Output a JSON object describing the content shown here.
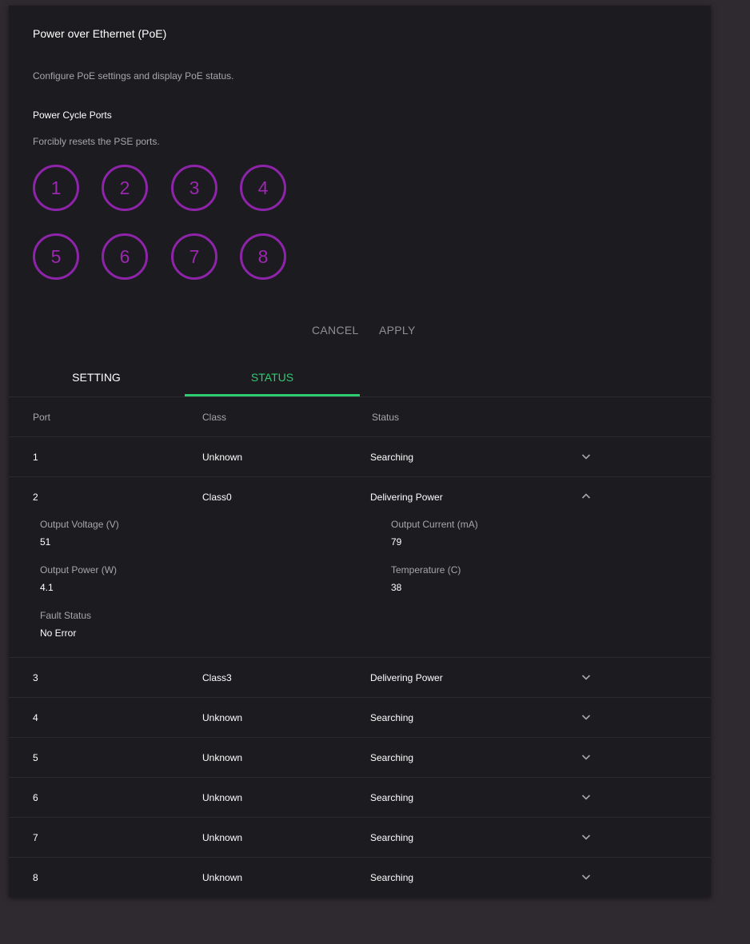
{
  "header": {
    "title": "Power over Ethernet (PoE)",
    "description": "Configure PoE settings and display PoE status."
  },
  "power_cycle": {
    "title": "Power Cycle Ports",
    "description": "Forcibly resets the PSE ports.",
    "ports": [
      "1",
      "2",
      "3",
      "4",
      "5",
      "6",
      "7",
      "8"
    ]
  },
  "actions": {
    "cancel": "CANCEL",
    "apply": "APPLY"
  },
  "tabs": {
    "setting": "SETTING",
    "status": "STATUS"
  },
  "table": {
    "headers": {
      "port": "Port",
      "class": "Class",
      "status": "Status"
    },
    "rows": [
      {
        "port": "1",
        "class": "Unknown",
        "status": "Searching"
      },
      {
        "port": "2",
        "class": "Class0",
        "status": "Delivering Power"
      },
      {
        "port": "3",
        "class": "Class3",
        "status": "Delivering Power"
      },
      {
        "port": "4",
        "class": "Unknown",
        "status": "Searching"
      },
      {
        "port": "5",
        "class": "Unknown",
        "status": "Searching"
      },
      {
        "port": "6",
        "class": "Unknown",
        "status": "Searching"
      },
      {
        "port": "7",
        "class": "Unknown",
        "status": "Searching"
      },
      {
        "port": "8",
        "class": "Unknown",
        "status": "Searching"
      }
    ],
    "expanded_detail": {
      "output_voltage_label": "Output Voltage (V)",
      "output_voltage": "51",
      "output_current_label": "Output Current (mA)",
      "output_current": "79",
      "output_power_label": "Output Power (W)",
      "output_power": "4.1",
      "temperature_label": "Temperature (C)",
      "temperature": "38",
      "fault_status_label": "Fault Status",
      "fault_status": "No Error"
    }
  },
  "colors": {
    "accent_purple": "#9c27b0",
    "accent_green": "#2ecc71",
    "card_bg": "#1c1b1f",
    "page_bg": "#2e2a2f"
  }
}
